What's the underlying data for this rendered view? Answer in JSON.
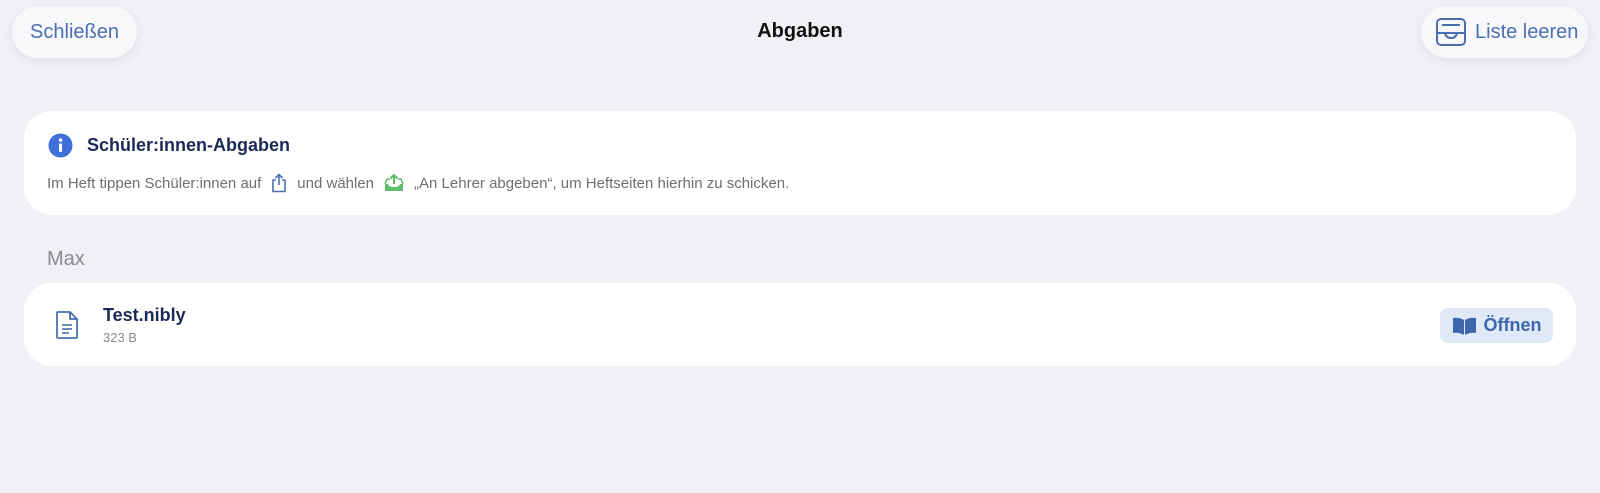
{
  "header": {
    "close_label": "Schließen",
    "title": "Abgaben",
    "clear_label": "Liste leeren",
    "clear_icon": "tray-icon"
  },
  "info": {
    "icon": "info-icon",
    "title": "Schüler:innen-Abgaben",
    "text_part1": "Im Heft tippen Schüler:innen auf",
    "share_icon": "share-icon",
    "text_part2": "und wählen",
    "submit_icon": "submit-tray-icon",
    "text_part3": "„An Lehrer abgeben“, um Heftseiten hierhin zu schicken."
  },
  "section": {
    "label": "Max"
  },
  "files": [
    {
      "icon": "document-icon",
      "name": "Test.nibly",
      "size": "323 B",
      "open_label": "Öffnen",
      "open_icon": "book-icon"
    }
  ],
  "colors": {
    "background": "#f0f0f5",
    "accent": "#4a6fb0",
    "title_text": "#1b2a55",
    "submit_green": "#5fbf6a",
    "open_button_bg": "#dfe9f8"
  }
}
